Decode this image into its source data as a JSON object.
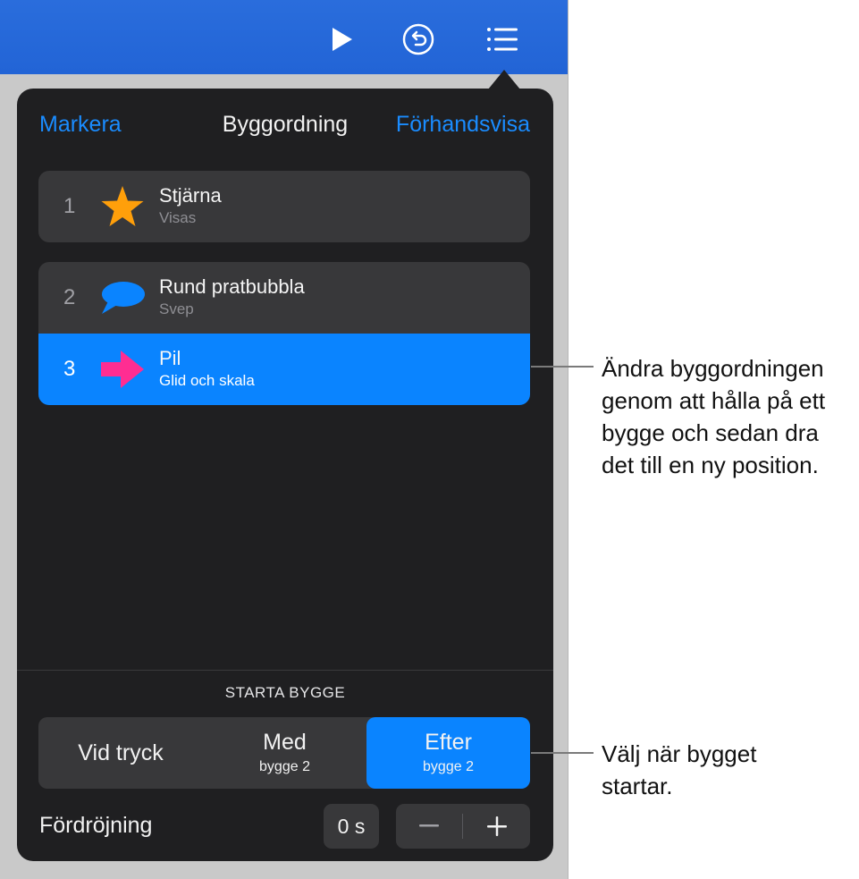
{
  "toolbar": {
    "icons": [
      "play-icon",
      "undo-icon",
      "list-icon"
    ],
    "accent": "#2264d6"
  },
  "popover": {
    "left_action": "Markera",
    "title": "Byggordning",
    "right_action": "Förhandsvisa",
    "items": [
      {
        "number": "1",
        "name": "Stjärna",
        "effect": "Visas",
        "icon": "star-icon",
        "icon_color": "#ff9f0a",
        "selected": false
      },
      {
        "number": "2",
        "name": "Rund pratbubbla",
        "effect": "Svep",
        "icon": "speech-bubble-icon",
        "icon_color": "#0a84ff",
        "selected": false
      },
      {
        "number": "3",
        "name": "Pil",
        "effect": "Glid och skala",
        "icon": "arrow-icon",
        "icon_color": "#ff2d92",
        "selected": true
      }
    ],
    "section_label": "STARTA BYGGE",
    "start_options": [
      {
        "label": "Vid tryck",
        "sub": "",
        "selected": false
      },
      {
        "label": "Med",
        "sub": "bygge 2",
        "selected": false
      },
      {
        "label": "Efter",
        "sub": "bygge 2",
        "selected": true
      }
    ],
    "delay": {
      "label": "Fördröjning",
      "value": "0 s"
    }
  },
  "callouts": {
    "order": "Ändra byggordningen genom att hålla på ett bygge och sedan dra det till en ny position.",
    "start": "Välj när bygget startar."
  },
  "colors": {
    "selected": "#0a84ff",
    "popover_bg": "#1f1f21",
    "row_bg": "#38383a"
  }
}
